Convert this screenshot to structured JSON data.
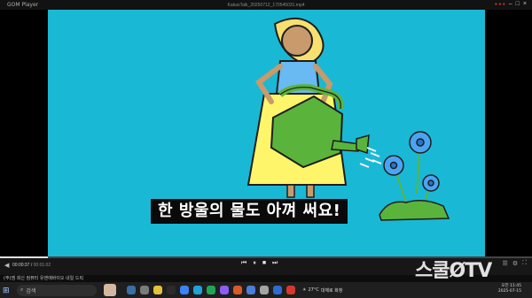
{
  "titlebar": {
    "app_name": "GOM Player",
    "filename": "KakaoTalk_20250712_170545031.mp4",
    "rec_indicator": "● ● ●"
  },
  "video": {
    "subtitle": "한 방울의 물도 아껴 써요!"
  },
  "controlbar": {
    "current_time": "00:00:37",
    "total_time": "00:01:02",
    "progress": 0.09,
    "buttons": [
      "prev",
      "pause",
      "stop",
      "next"
    ]
  },
  "ticker": {
    "text": "(주)엠 회신 컴퓨터 유엔에바이오 내일 드릭"
  },
  "taskbar": {
    "search_label": "검색",
    "weather_temp": "27°C",
    "weather_desc": "대체로 화창",
    "time": "오전 11:45",
    "date": "2025-07-15"
  },
  "watermark": {
    "text": "스쿨ØTV"
  },
  "colors": {
    "video_bg": "#19b9d6",
    "watering_can": "#5ab43c",
    "dress": "#fff56a",
    "shirt": "#69b9f2",
    "hair": "#f7e070",
    "flower": "#4aa4f2"
  }
}
